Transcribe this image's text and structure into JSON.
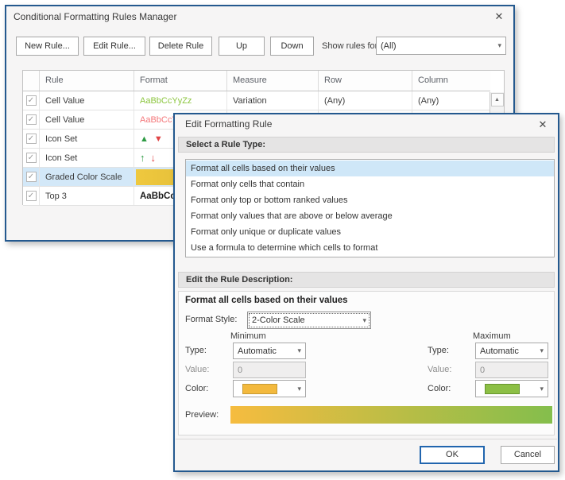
{
  "icons": {
    "close": "✕",
    "dropdown_arrow": "▾",
    "checkbox_check": "✓",
    "triangle_up": "▲",
    "triangle_down": "▼",
    "arrow_up": "↑",
    "arrow_down": "↓",
    "scroll_up_arrow": "▲"
  },
  "colors": {
    "dialog_border": "#24598F",
    "selection_blue": "#D3E8F8",
    "icon_green": "#2E9B44",
    "icon_red": "#E04345",
    "graded_swatch_from": "#EFC83E",
    "graded_swatch_to": "#DDBA37",
    "min_color_swatch": "#F3B93D",
    "min_color_swatch_border": "#C79B35",
    "max_color_swatch": "#8CBF45",
    "max_color_swatch_border": "#68952F",
    "preview_from": "#F6BC3F",
    "preview_to": "#84BE4C"
  },
  "rules_manager": {
    "title": "Conditional Formatting Rules Manager",
    "toolbar": {
      "new_rule_label": "New Rule...",
      "edit_rule_label": "Edit Rule...",
      "delete_rule_label": "Delete Rule",
      "up_label": "Up",
      "down_label": "Down",
      "show_rules_for_label": "Show rules for:",
      "show_rules_for_value": "(All)"
    },
    "table": {
      "columns": [
        "",
        "Rule",
        "Format",
        "Measure",
        "Row",
        "Column"
      ],
      "rows": [
        {
          "checked": true,
          "selected": false,
          "rule": "Cell Value",
          "format": {
            "kind": "text",
            "text": "AaBbCcYyZz",
            "color": "#8CC63F"
          },
          "measure": "Variation",
          "row": "(Any)",
          "column": "(Any)"
        },
        {
          "checked": true,
          "selected": false,
          "rule": "Cell Value",
          "format": {
            "kind": "text",
            "text": "AaBbCcYyZz",
            "color": "#F4777A"
          },
          "measure": "",
          "row": "",
          "column": ""
        },
        {
          "checked": true,
          "selected": false,
          "rule": "Icon Set",
          "format": {
            "kind": "triangles"
          },
          "measure": "",
          "row": "",
          "column": ""
        },
        {
          "checked": true,
          "selected": false,
          "rule": "Icon Set",
          "format": {
            "kind": "arrows"
          },
          "measure": "",
          "row": "",
          "column": ""
        },
        {
          "checked": true,
          "selected": true,
          "rule": "Graded Color Scale",
          "format": {
            "kind": "gradient_swatch"
          },
          "measure": "",
          "row": "",
          "column": ""
        },
        {
          "checked": true,
          "selected": false,
          "rule": "Top 3",
          "format": {
            "kind": "bold_text",
            "text": "AaBbCcYyZz",
            "color": "#1A1A1A"
          },
          "measure": "",
          "row": "",
          "column": ""
        }
      ]
    }
  },
  "edit_rule_dialog": {
    "title": "Edit Formatting Rule",
    "select_rule_type_header": "Select a Rule Type:",
    "rule_types": [
      "Format all cells based on their values",
      "Format only cells that contain",
      "Format only top or bottom ranked values",
      "Format only values that are above or below average",
      "Format only unique or duplicate values",
      "Use a formula to determine which cells to format"
    ],
    "selected_rule_type_index": 0,
    "edit_description_header": "Edit the Rule Description:",
    "description_title": "Format all cells based on their values",
    "format_style_label": "Format Style:",
    "format_style_value": "2-Color Scale",
    "minimum_header": "Minimum",
    "maximum_header": "Maximum",
    "minimum": {
      "type_label": "Type:",
      "type_value": "Automatic",
      "value_label": "Value:",
      "value": "0",
      "color_label": "Color:"
    },
    "maximum": {
      "type_label": "Type:",
      "type_value": "Automatic",
      "value_label": "Value:",
      "value": "0",
      "color_label": "Color:"
    },
    "preview_label": "Preview:",
    "ok_label": "OK",
    "cancel_label": "Cancel"
  }
}
